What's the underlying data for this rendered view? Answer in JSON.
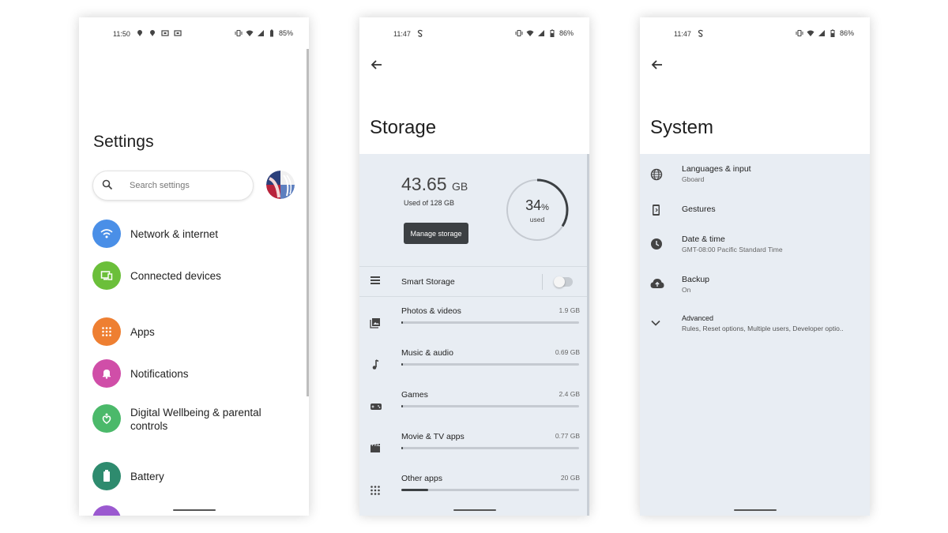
{
  "settings_screen": {
    "status": {
      "time": "11:50",
      "battery": "85%"
    },
    "title": "Settings",
    "search_placeholder": "Search settings",
    "items": [
      {
        "label": "Network & internet",
        "icon": "wifi-icon",
        "color": "#4a8fe7"
      },
      {
        "label": "Connected devices",
        "icon": "devices-icon",
        "color": "#6bbf3a"
      },
      {
        "label": "Apps",
        "icon": "apps-grid-icon",
        "color": "#ee7f32"
      },
      {
        "label": "Notifications",
        "icon": "bell-icon",
        "color": "#d04ea8"
      },
      {
        "label": "Digital Wellbeing & parental controls",
        "icon": "wellbeing-icon",
        "color": "#4bb96a"
      },
      {
        "label": "Battery",
        "icon": "battery-icon",
        "color": "#2e8b6e"
      }
    ]
  },
  "storage_screen": {
    "status": {
      "time": "11:47",
      "battery": "86%"
    },
    "title": "Storage",
    "used_amount": "43.65",
    "used_unit": "GB",
    "used_of": "Used of 128 GB",
    "manage_label": "Manage storage",
    "percent_number": "34",
    "percent_sign": "%",
    "percent_caption": "used",
    "percent_value": 0.34,
    "smart_storage_label": "Smart Storage",
    "smart_storage_on": false,
    "categories": [
      {
        "label": "Photos & videos",
        "size": "1.9 GB",
        "fraction": 0.01,
        "icon": "photos-icon"
      },
      {
        "label": "Music & audio",
        "size": "0.69 GB",
        "fraction": 0.0,
        "icon": "music-note-icon"
      },
      {
        "label": "Games",
        "size": "2.4 GB",
        "fraction": 0.01,
        "icon": "gamepad-icon"
      },
      {
        "label": "Movie & TV apps",
        "size": "0.77 GB",
        "fraction": 0.0,
        "icon": "movie-icon"
      },
      {
        "label": "Other apps",
        "size": "20 GB",
        "fraction": 0.15,
        "icon": "apps-grid-icon"
      }
    ]
  },
  "system_screen": {
    "status": {
      "time": "11:47",
      "battery": "86%"
    },
    "title": "System",
    "items": [
      {
        "title": "Languages & input",
        "subtitle": "Gboard",
        "icon": "globe-icon"
      },
      {
        "title": "Gestures",
        "subtitle": "",
        "icon": "gestures-phone-icon"
      },
      {
        "title": "Date & time",
        "subtitle": "GMT-08:00 Pacific Standard Time",
        "icon": "clock-icon"
      },
      {
        "title": "Backup",
        "subtitle": "On",
        "icon": "cloud-upload-icon"
      },
      {
        "title": "Advanced",
        "subtitle": "Rules, Reset options, Multiple users, Developer optio..",
        "icon": "chevron-down-icon"
      }
    ]
  }
}
